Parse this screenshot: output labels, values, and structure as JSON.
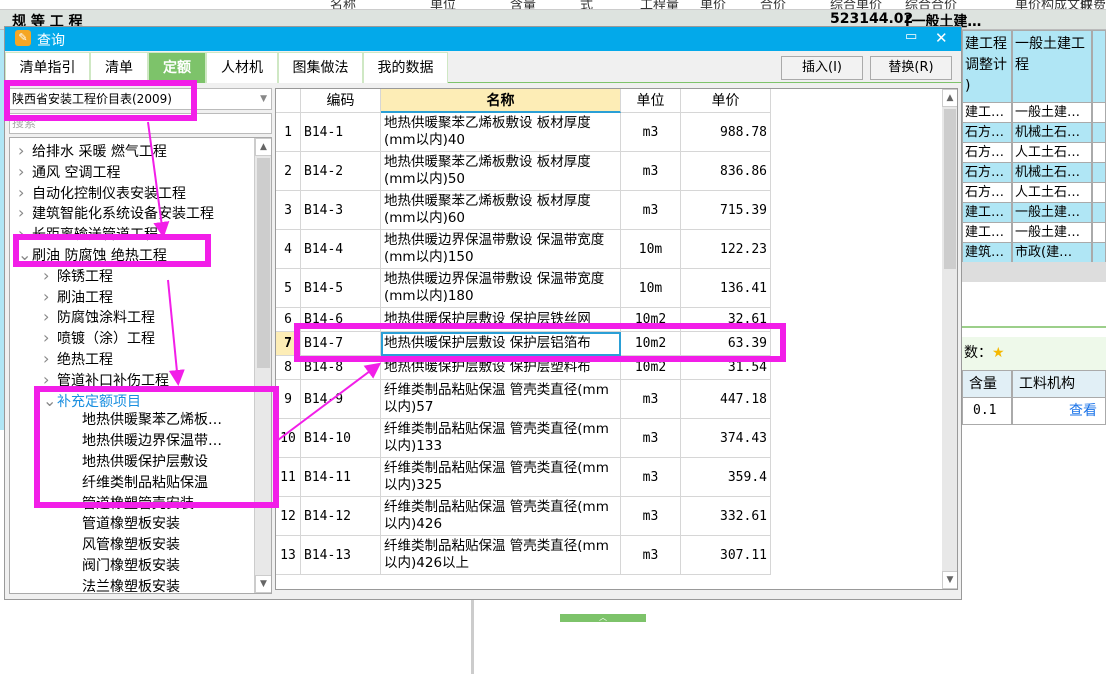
{
  "background": {
    "header_cols": [
      "名称",
      "单位",
      "含量",
      "式",
      "工程量",
      "单价",
      "合价",
      "综合单价",
      "综合合价",
      "单价构成文件",
      "取费专业"
    ],
    "row2": {
      "name": "规 等 工 程",
      "total": "523144.02",
      "file": "[一般土建…"
    },
    "right_rows": [
      [
        "建工程\n调整计\n)",
        "一般土建工\n程"
      ],
      [
        "建工…",
        "一般土建…"
      ],
      [
        "石方…",
        "机械土石…"
      ],
      [
        "石方…",
        "人工土石…"
      ],
      [
        "石方…",
        "机械土石…"
      ],
      [
        "石方…",
        "人工土石…"
      ],
      [
        "建工…",
        "一般土建…"
      ],
      [
        "建工…",
        "一般土建…"
      ],
      [
        "建筑…",
        "市政(建…"
      ]
    ],
    "lower_panel": {
      "label": "数：",
      "col_qty": "含量",
      "col_struct": "工料机构",
      "qty": "0.1",
      "view_link": "查看"
    }
  },
  "dialog": {
    "title": "查询",
    "tabs": [
      "清单指引",
      "清单",
      "定额",
      "人材机",
      "图集做法",
      "我的数据"
    ],
    "active_tab": 2,
    "insert_button": "插入(I)",
    "replace_button": "替换(R)",
    "library_select": "陕西省安装工程价目表(2009)",
    "search_placeholder": "搜索",
    "tree": [
      {
        "label": "给排水 采暖 燃气工程",
        "level": 0,
        "state": "collapsed"
      },
      {
        "label": "通风 空调工程",
        "level": 0,
        "state": "collapsed"
      },
      {
        "label": "自动化控制仪表安装工程",
        "level": 0,
        "state": "collapsed"
      },
      {
        "label": "建筑智能化系统设备安装工程",
        "level": 0,
        "state": "collapsed"
      },
      {
        "label": "长距离输送管道工程",
        "level": 0,
        "state": "collapsed"
      },
      {
        "label": "刷油 防腐蚀 绝热工程",
        "level": 0,
        "state": "expanded"
      },
      {
        "label": "除锈工程",
        "level": 1,
        "state": "collapsed"
      },
      {
        "label": "刷油工程",
        "level": 1,
        "state": "collapsed"
      },
      {
        "label": "防腐蚀涂料工程",
        "level": 1,
        "state": "collapsed"
      },
      {
        "label": "喷镀（涂）工程",
        "level": 1,
        "state": "collapsed"
      },
      {
        "label": "绝热工程",
        "level": 1,
        "state": "collapsed"
      },
      {
        "label": "管道补口补伤工程",
        "level": 1,
        "state": "collapsed"
      },
      {
        "label": "补充定额项目",
        "level": 1,
        "state": "expanded",
        "selected": true
      },
      {
        "label": "地热供暖聚苯乙烯板…",
        "level": 2
      },
      {
        "label": "地热供暖边界保温带…",
        "level": 2
      },
      {
        "label": "地热供暖保护层敷设",
        "level": 2
      },
      {
        "label": "纤维类制品粘贴保温",
        "level": 2
      },
      {
        "label": "管道橡塑管壳安装",
        "level": 2
      },
      {
        "label": "管道橡塑板安装",
        "level": 2
      },
      {
        "label": "风管橡塑板安装",
        "level": 2
      },
      {
        "label": "阀门橡塑板安装",
        "level": 2
      },
      {
        "label": "法兰橡塑板安装",
        "level": 2
      }
    ],
    "table": {
      "headers": {
        "code": "编码",
        "name": "名称",
        "unit": "单位",
        "price": "单价"
      },
      "selected_row": 7,
      "rows": [
        {
          "n": "1",
          "code": "B14-1",
          "name": "地热供暖聚苯乙烯板敷设 板材厚度(mm以内)40",
          "unit": "m3",
          "price": "988.78"
        },
        {
          "n": "2",
          "code": "B14-2",
          "name": "地热供暖聚苯乙烯板敷设 板材厚度(mm以内)50",
          "unit": "m3",
          "price": "836.86"
        },
        {
          "n": "3",
          "code": "B14-3",
          "name": "地热供暖聚苯乙烯板敷设 板材厚度(mm以内)60",
          "unit": "m3",
          "price": "715.39"
        },
        {
          "n": "4",
          "code": "B14-4",
          "name": "地热供暖边界保温带敷设 保温带宽度(mm以内)150",
          "unit": "10m",
          "price": "122.23"
        },
        {
          "n": "5",
          "code": "B14-5",
          "name": "地热供暖边界保温带敷设 保温带宽度(mm以内)180",
          "unit": "10m",
          "price": "136.41"
        },
        {
          "n": "6",
          "code": "B14-6",
          "name": "地热供暖保护层敷设 保护层铁丝网",
          "unit": "10m2",
          "price": "32.61"
        },
        {
          "n": "7",
          "code": "B14-7",
          "name": "地热供暖保护层敷设 保护层铝箔布",
          "unit": "10m2",
          "price": "63.39"
        },
        {
          "n": "8",
          "code": "B14-8",
          "name": "地热供暖保护层敷设 保护层塑料布",
          "unit": "10m2",
          "price": "31.54"
        },
        {
          "n": "9",
          "code": "B14-9",
          "name": "纤维类制品粘贴保温 管壳类直径(mm以内)57",
          "unit": "m3",
          "price": "447.18"
        },
        {
          "n": "10",
          "code": "B14-10",
          "name": "纤维类制品粘贴保温 管壳类直径(mm以内)133",
          "unit": "m3",
          "price": "374.43"
        },
        {
          "n": "11",
          "code": "B14-11",
          "name": "纤维类制品粘贴保温 管壳类直径(mm以内)325",
          "unit": "m3",
          "price": "359.4"
        },
        {
          "n": "12",
          "code": "B14-12",
          "name": "纤维类制品粘贴保温 管壳类直径(mm以内)426",
          "unit": "m3",
          "price": "332.61"
        },
        {
          "n": "13",
          "code": "B14-13",
          "name": "纤维类制品粘贴保温 管壳类直径(mm以内)426以上",
          "unit": "m3",
          "price": "307.11"
        }
      ]
    }
  },
  "colors": {
    "titlebar": "#03a9ea",
    "tab_active": "#7dc36a",
    "annotation": "#f21ee8",
    "link": "#1a73e8"
  }
}
